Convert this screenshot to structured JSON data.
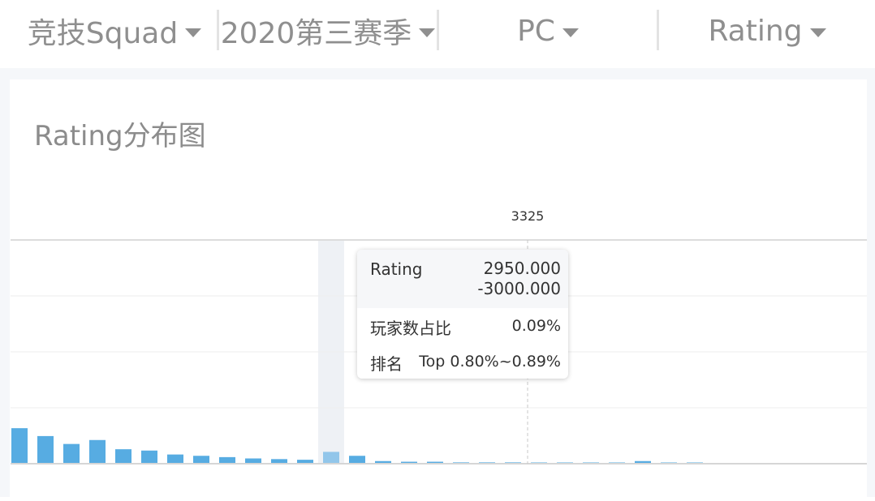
{
  "filters": [
    {
      "label": "竞技Squad"
    },
    {
      "label": "2020第三赛季"
    },
    {
      "label": "PC"
    },
    {
      "label": "Rating"
    }
  ],
  "card": {
    "title": "Rating分布图"
  },
  "tooltip": {
    "row1_label": "Rating",
    "row1_value_line1": "2950.000",
    "row1_value_line2": "-3000.000",
    "row2_label": "玩家数占比",
    "row2_value": "0.09%",
    "row3_label": "排名",
    "row3_value": "Top 0.80%~0.89%"
  },
  "colors": {
    "bar": "#57ace2",
    "bar_highlight": "#92c6ea",
    "hover_band": "#eef1f5",
    "grid": "#eeeeee",
    "axis": "#d6d6d6",
    "text": "#8a8a8a"
  },
  "chart_data": {
    "type": "bar",
    "title": "Rating分布图",
    "xlabel": "",
    "ylabel": "",
    "grid": true,
    "hover_index": 12,
    "ylim": [
      0,
      1.7
    ],
    "marker": {
      "label": "3325",
      "x_value": 3325
    },
    "x_bin_start": 2350,
    "x_bin_width": 50,
    "values": [
      0.27,
      0.21,
      0.15,
      0.18,
      0.11,
      0.1,
      0.07,
      0.06,
      0.05,
      0.04,
      0.035,
      0.03,
      0.09,
      0.06,
      0.02,
      0.015,
      0.015,
      0.01,
      0.01,
      0.01,
      0.008,
      0.008,
      0.008,
      0.008,
      0.02,
      0.006,
      0.006
    ]
  }
}
